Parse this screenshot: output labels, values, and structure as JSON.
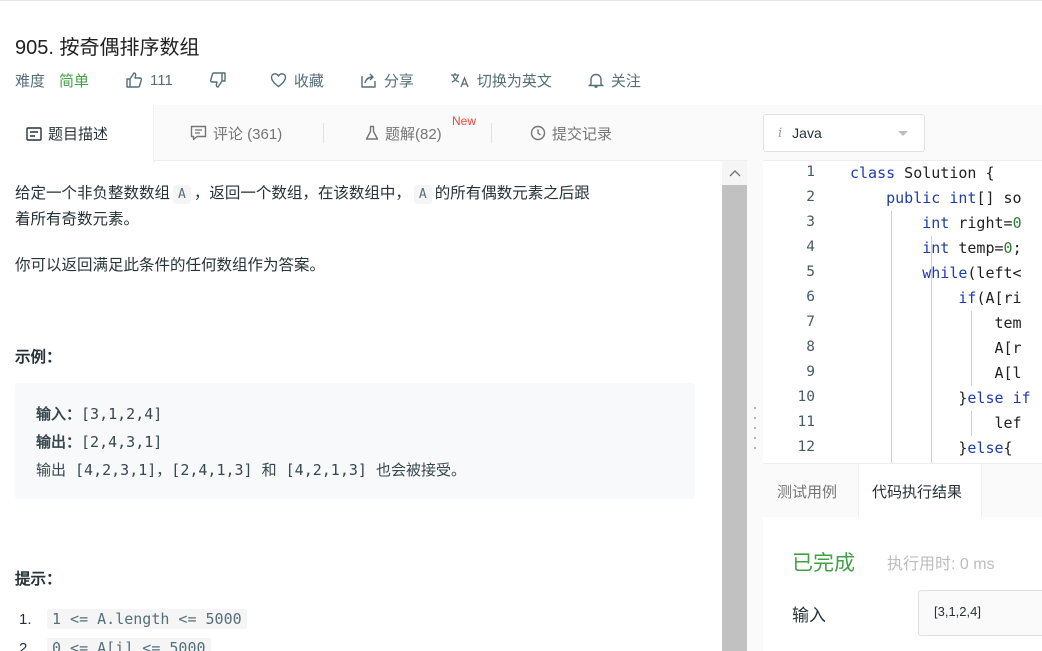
{
  "problem": {
    "title": "905. 按奇偶排序数组",
    "difficulty_label": "难度",
    "difficulty_value": "简单",
    "likes": "111",
    "favorite_label": "收藏",
    "share_label": "分享",
    "switch_lang_label": "切换为英文",
    "follow_label": "关注"
  },
  "left_tabs": {
    "description": "题目描述",
    "comments": "评论 (361)",
    "solutions": "题解(82)",
    "new_badge": "New",
    "submissions": "提交记录"
  },
  "description": {
    "p1_a": "给定一个非负整数数组",
    "p1_code1": "A",
    "p1_b": "，返回一个数组，在该数组中，",
    "p1_code2": "A",
    "p1_c": "的所有偶数元素之后跟",
    "p1_d": "着所有奇数元素。",
    "p2": "你可以返回满足此条件的任何数组作为答案。",
    "example_heading": "示例：",
    "example_input_label": "输入：",
    "example_input_value": "[3,1,2,4]",
    "example_output_label": "输出：",
    "example_output_value": "[2,4,3,1]",
    "example_note": "输出 [4,2,3,1]，[2,4,1,3] 和 [4,2,1,3] 也会被接受。",
    "hint_heading": "提示：",
    "hints": [
      {
        "num": "1.",
        "code": "1 <= A.length <= 5000"
      },
      {
        "num": "2.",
        "code": "0 <= A[i] <= 5000"
      }
    ]
  },
  "editor": {
    "language": "Java",
    "lines": [
      {
        "n": "1"
      },
      {
        "n": "2"
      },
      {
        "n": "3"
      },
      {
        "n": "4"
      },
      {
        "n": "5"
      },
      {
        "n": "6"
      },
      {
        "n": "7"
      },
      {
        "n": "8"
      },
      {
        "n": "9"
      },
      {
        "n": "10"
      },
      {
        "n": "11"
      },
      {
        "n": "12"
      }
    ]
  },
  "bottom_tabs": {
    "testcase": "测试用例",
    "result": "代码执行结果"
  },
  "result": {
    "status": "已完成",
    "runtime": "执行用时: 0 ms",
    "input_label": "输入",
    "input_value": "[3,1,2,4]"
  }
}
